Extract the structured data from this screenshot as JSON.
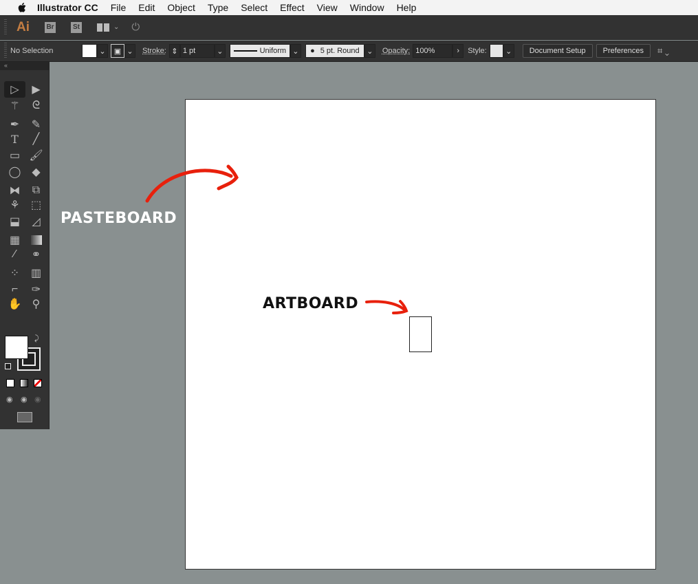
{
  "menubar": {
    "app": "Illustrator CC",
    "items": [
      "File",
      "Edit",
      "Object",
      "Type",
      "Select",
      "Effect",
      "View",
      "Window",
      "Help"
    ]
  },
  "appbar": {
    "logo": "Ai",
    "bridge": "Br",
    "stock": "St"
  },
  "control": {
    "selection": "No Selection",
    "stroke_label": "Stroke:",
    "stroke_value": "1 pt",
    "profile": "Uniform",
    "brush": "5 pt. Round",
    "opacity_label": "Opacity:",
    "opacity_value": "100%",
    "style_label": "Style:",
    "document_setup": "Document Setup",
    "preferences": "Preferences"
  },
  "annotations": {
    "pasteboard": "PASTEBOARD",
    "artboard": "ARTBOARD",
    "color": "#e8200c"
  },
  "tools": [
    "selection",
    "direct-selection",
    "magic-wand",
    "lasso",
    "pen",
    "curvature",
    "type",
    "line-segment",
    "rectangle",
    "paintbrush",
    "shaper",
    "eraser",
    "reflect",
    "scale",
    "puppet-warp",
    "free-transform",
    "shape-builder",
    "perspective-grid",
    "mesh",
    "gradient",
    "eyedropper",
    "blend",
    "symbol-sprayer",
    "column-graph",
    "artboard",
    "slice",
    "hand",
    "zoom"
  ]
}
